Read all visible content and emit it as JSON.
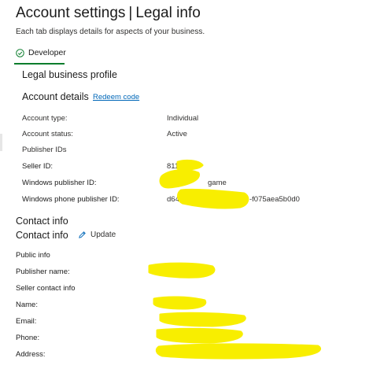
{
  "header": {
    "title": "Account settings",
    "separator": "|",
    "section": "Legal info",
    "subtitle": "Each tab displays details for aspects of your business."
  },
  "tabs": [
    {
      "label": "Developer",
      "selected": true,
      "icon": "check-circle-icon"
    }
  ],
  "legal_profile": {
    "heading": "Legal business profile",
    "account_details": {
      "heading": "Account details",
      "redeem_link": "Redeem code",
      "fields": [
        {
          "label": "Account type:",
          "value": "Individual"
        },
        {
          "label": "Account status:",
          "value": "Active"
        }
      ],
      "publisher_ids": {
        "heading": "Publisher IDs",
        "fields": [
          {
            "label": "Seller ID:",
            "value": "811"
          },
          {
            "label": "Windows publisher ID:",
            "value": "game"
          },
          {
            "label": "Windows phone publisher ID:",
            "value_start": "d64",
            "value_end": "-f075aea5b0d0"
          }
        ]
      }
    }
  },
  "contact": {
    "section_heading": "Contact info",
    "heading": "Contact info",
    "update_label": "Update",
    "update_icon": "pencil-icon",
    "public_info": {
      "heading": "Public info",
      "fields": [
        {
          "label": "Publisher name:"
        }
      ]
    },
    "seller_contact": {
      "heading": "Seller contact info",
      "fields": [
        {
          "label": "Name:"
        },
        {
          "label": "Email:"
        },
        {
          "label": "Phone:"
        },
        {
          "label": "Address:"
        }
      ]
    }
  },
  "colors": {
    "accent_green": "#0a7d2c",
    "link_blue": "#0067b8",
    "redaction_yellow": "#f8ee00"
  }
}
